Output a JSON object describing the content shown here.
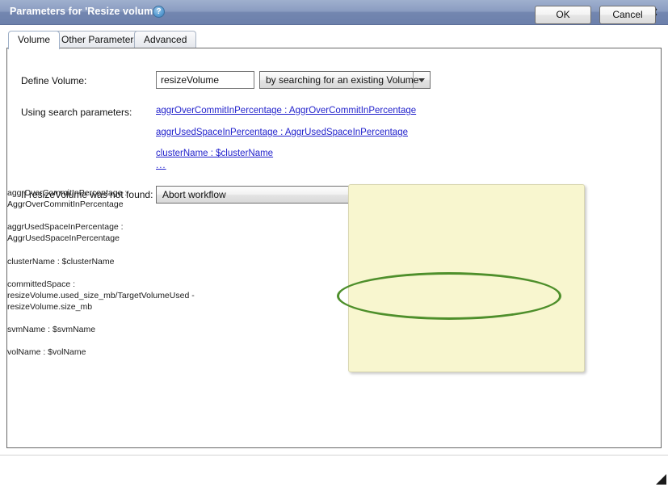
{
  "window": {
    "title": "Parameters for 'Resize volume'",
    "help_icon": "question-mark-icon",
    "close_icon": "✕"
  },
  "tabs": [
    {
      "label": "Volume",
      "active": true
    },
    {
      "label": "Other Parameters",
      "active": false
    },
    {
      "label": "Advanced",
      "active": false
    }
  ],
  "form": {
    "define_volume_label": "Define Volume:",
    "volume_name_value": "resizeVolume",
    "volume_name_placeholder": "",
    "define_mode_value": "by searching for an existing Volume",
    "using_search_parameters_label": "Using search parameters:",
    "search_parameters": [
      "aggrOverCommitInPercentage  :   AggrOverCommitInPercentage",
      "aggrUsedSpaceInPercentage  :   AggrUsedSpaceInPercentage",
      "clusterName  :  $clusterName",
      "..."
    ],
    "not_found_label": "If resizeVolume was not found:",
    "not_found_value": "Abort workflow"
  },
  "tooltip": {
    "items": [
      "aggrOverCommitInPercentage  :\nAggrOverCommitInPercentage",
      "aggrUsedSpaceInPercentage  :\nAggrUsedSpaceInPercentage",
      "clusterName  :  $clusterName",
      "committedSpace  :\nresizeVolume.used_size_mb/TargetVolumeUsed -\nresizeVolume.size_mb",
      "svmName  :  $svmName",
      "volName  :  $volName"
    ],
    "highlight_color": "#4e8f2b",
    "background_color": "#f8f6cf"
  },
  "footer": {
    "ok_label": "OK",
    "cancel_label": "Cancel"
  }
}
